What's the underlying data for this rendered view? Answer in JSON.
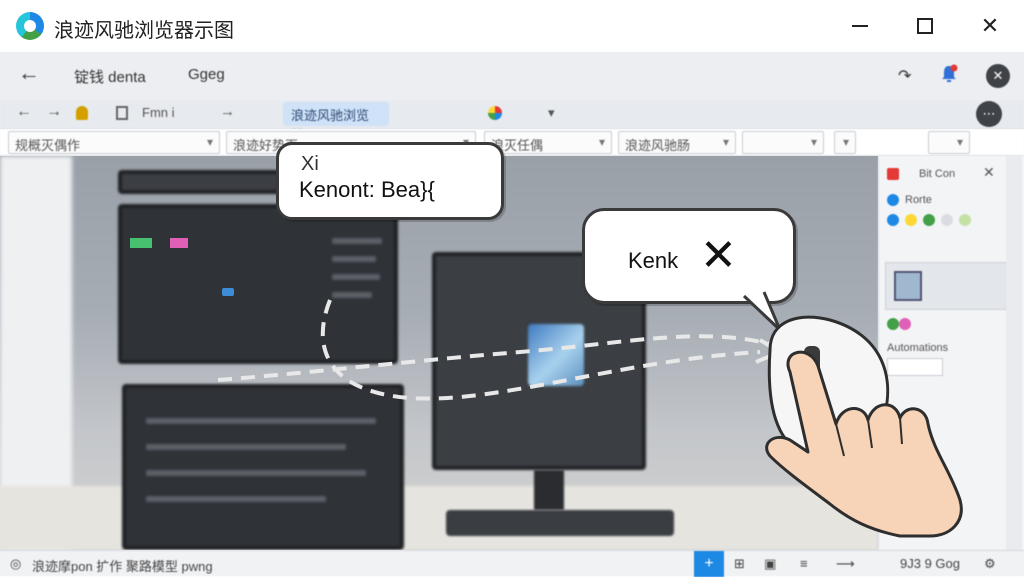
{
  "window": {
    "title": "浪迹风驰浏览器示图",
    "controls": {
      "minimize": "–",
      "maximize": "□",
      "close": "✕"
    }
  },
  "toolbar": {
    "back_icon": "←",
    "item1": "锭钱 denta",
    "item2": "Ggeg",
    "refresh_icon": "↷",
    "close_icon": "✕"
  },
  "navbar": {
    "back": "←",
    "forward": "→",
    "item_from": "Fmn i",
    "address": "浪迹风驰浏览器",
    "more": "▾"
  },
  "filters": {
    "dd1": "规概灭偶作",
    "dd2": "浪迹好势页",
    "dd3": "浪灭任偶",
    "dd4": "浪迹风驰肠"
  },
  "bubbles": {
    "b1_small": "Xi",
    "b1_big": "Kenont: Bea}{",
    "b2_text": "Kenk",
    "b2_icon": "✕"
  },
  "sidebar": {
    "header": "Bit Con",
    "label1": "Rorte",
    "label2": "Automations"
  },
  "statusbar": {
    "left_text": "浪迹摩pon 扩作 聚路模型 pwng",
    "active_icon": "+",
    "right_text": "9J3 9 Gog",
    "gear_icon": "⚙"
  },
  "colors": {
    "accent": "#1e88e5",
    "url_pill": "#cfe2f8",
    "green": "#47c070",
    "pink": "#e060b8"
  }
}
